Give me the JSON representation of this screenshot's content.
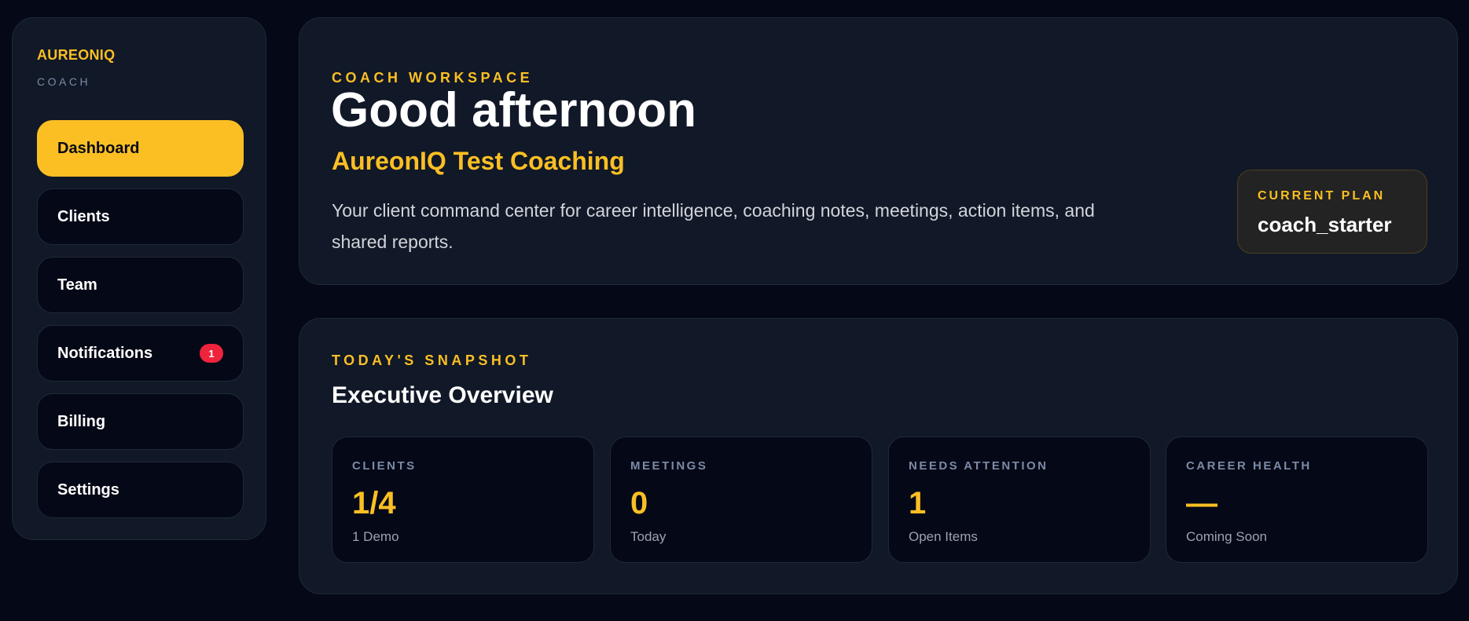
{
  "brand": {
    "name": "AUREONIQ",
    "role": "COACH"
  },
  "sidebar": {
    "items": [
      {
        "label": "Dashboard",
        "active": true
      },
      {
        "label": "Clients"
      },
      {
        "label": "Team"
      },
      {
        "label": "Notifications",
        "badge": "1"
      },
      {
        "label": "Billing"
      },
      {
        "label": "Settings"
      }
    ]
  },
  "hero": {
    "eyebrow": "COACH WORKSPACE",
    "title": "Good afternoon",
    "subtitle": "AureonIQ Test Coaching",
    "description": "Your client command center for career intelligence, coaching notes, meetings, action items, and shared reports.",
    "plan_label": "CURRENT PLAN",
    "plan_value": "coach_starter"
  },
  "snapshot": {
    "eyebrow": "TODAY'S SNAPSHOT",
    "title": "Executive Overview",
    "stats": [
      {
        "label": "CLIENTS",
        "value": "1/4",
        "sub": "1 Demo"
      },
      {
        "label": "MEETINGS",
        "value": "0",
        "sub": "Today"
      },
      {
        "label": "NEEDS ATTENTION",
        "value": "1",
        "sub": "Open Items"
      },
      {
        "label": "CAREER HEALTH",
        "value": "—",
        "sub": "Coming Soon"
      }
    ]
  },
  "colors": {
    "background": "#050816",
    "panel": "#111827",
    "accent": "#fbbf24",
    "badge": "#ef233c",
    "muted": "#7c8aa5"
  }
}
